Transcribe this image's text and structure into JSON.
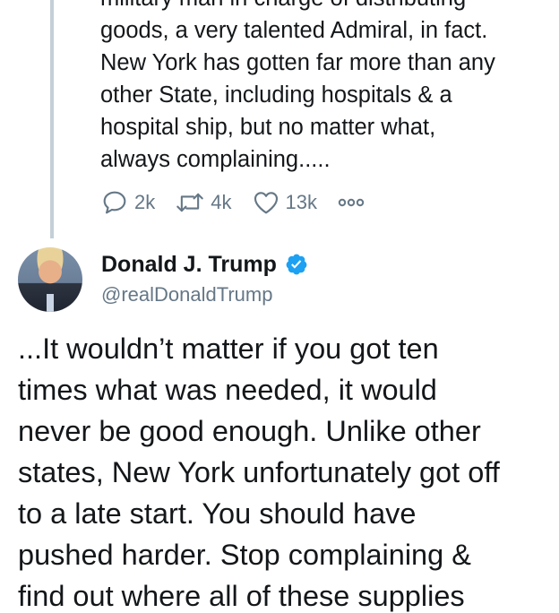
{
  "previous_tweet": {
    "text": "military man in charge of distributing\ngoods, a very talented Admiral, in fact.\nNew York has gotten far more than any\nother State, including hospitals & a\nhospital ship, but no matter what,\nalways complaining.....",
    "actions": {
      "replies": "2k",
      "retweets": "4k",
      "likes": "13k"
    }
  },
  "tweet": {
    "author_name": "Donald J. Trump",
    "handle": "@realDonaldTrump",
    "text": "...It wouldn’t matter if you got ten\ntimes what was needed, it would\nnever be good enough. Unlike other\nstates, New York unfortunately got off\nto a late start. You should have\npushed harder. Stop complaining &\nfind out where all of these supplies"
  },
  "icons": {
    "reply": "reply-icon",
    "retweet": "retweet-icon",
    "like": "heart-icon",
    "more": "more-icon",
    "verified": "verified-badge-icon"
  },
  "colors": {
    "text": "#14171a",
    "secondary": "#657786",
    "verified": "#1da1f2",
    "thread_line": "#c4cfd6"
  }
}
